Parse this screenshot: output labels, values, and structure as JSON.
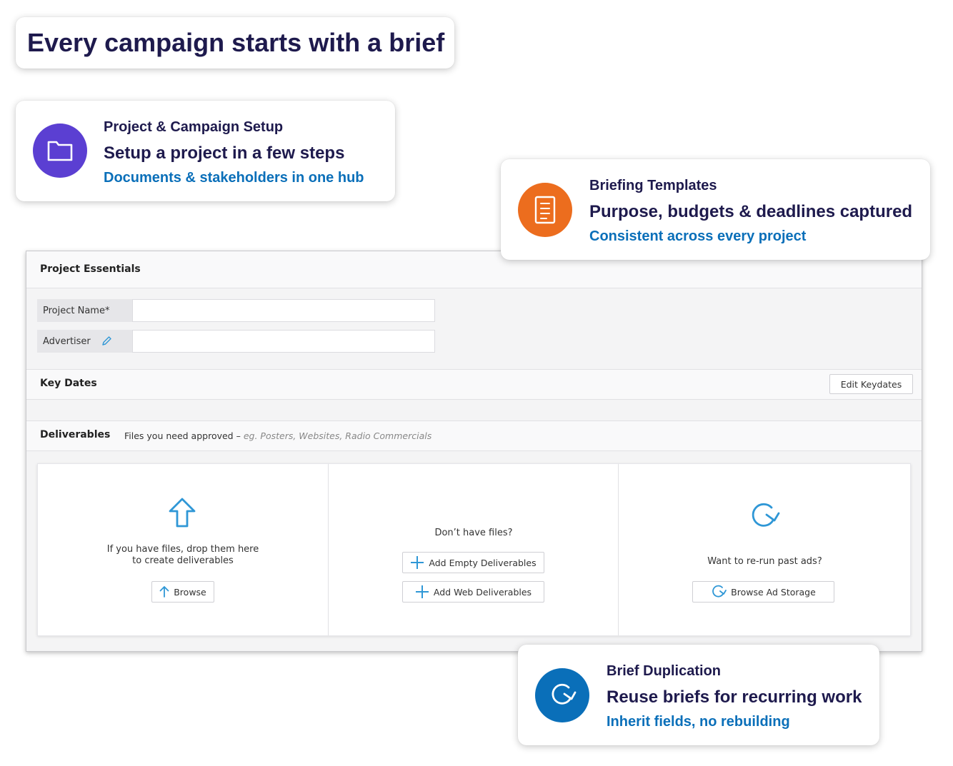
{
  "headline": "Every campaign starts with a brief",
  "features": [
    {
      "label": "Project & Campaign Setup",
      "title": "Setup a project in a few steps",
      "subtitle": "Documents & stakeholders in one hub",
      "icon": "folder-icon",
      "color": "#5b3fd2"
    },
    {
      "label": "Briefing Templates",
      "title": "Purpose, budgets & deadlines captured",
      "subtitle": "Consistent across every project",
      "icon": "document-icon",
      "color": "#ec6d1e"
    },
    {
      "label": "Brief Duplication",
      "title": "Reuse briefs for recurring work",
      "subtitle": "Inherit fields, no rebuilding",
      "icon": "refresh-icon",
      "color": "#0a6fb9"
    }
  ],
  "app": {
    "essentials": {
      "title": "Project Essentials",
      "fields": [
        {
          "label": "Project Name*",
          "value": ""
        },
        {
          "label": "Advertiser",
          "value": ""
        }
      ]
    },
    "key_dates": {
      "title": "Key Dates",
      "edit_button": "Edit Keydates"
    },
    "deliverables": {
      "title": "Deliverables",
      "hint": "Files you need approved –",
      "hint_example": "eg. Posters, Websites, Radio Commercials",
      "upload": {
        "text_line1": "If you have files, drop them here",
        "text_line2": "to create deliverables",
        "button": "Browse"
      },
      "empty": {
        "text": "Don’t have files?",
        "button_empty": "Add Empty Deliverables",
        "button_web": "Add Web Deliverables"
      },
      "rerun": {
        "text": "Want to re-run past ads?",
        "button": "Browse Ad Storage"
      }
    },
    "accent_color": "#2f97d6"
  }
}
